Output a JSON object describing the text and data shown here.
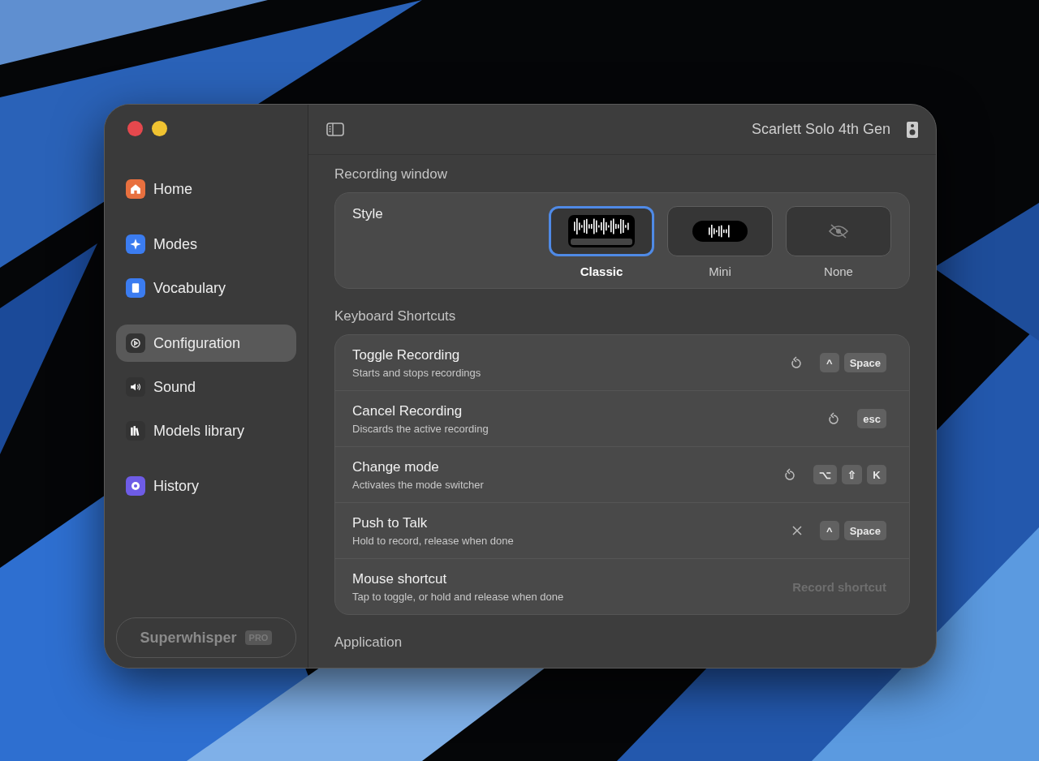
{
  "sidebar": {
    "traffic_lights": [
      {
        "color": "#e5484d"
      },
      {
        "color": "#f0c331"
      }
    ],
    "groups": [
      [
        {
          "label": "Home",
          "kind": "home",
          "color": "#e8703f",
          "selected": false
        }
      ],
      [
        {
          "label": "Modes",
          "kind": "sparkle",
          "color": "#3b7cf0",
          "selected": false
        },
        {
          "label": "Vocabulary",
          "kind": "book",
          "color": "#3b7cf0",
          "selected": false
        }
      ],
      [
        {
          "label": "Configuration",
          "kind": "gear",
          "color": "#333333",
          "selected": true
        },
        {
          "label": "Sound",
          "kind": "speaker",
          "color": "#333333",
          "selected": false
        },
        {
          "label": "Models library",
          "kind": "library",
          "color": "#333333",
          "selected": false
        }
      ],
      [
        {
          "label": "History",
          "kind": "shell",
          "color": "#6e5ce6",
          "selected": false
        }
      ]
    ],
    "footer": {
      "label": "Superwhisper",
      "badge": "PRO"
    }
  },
  "toolbar": {
    "device": "Scarlett Solo 4th Gen"
  },
  "recording_window": {
    "heading": "Recording window",
    "label": "Style",
    "options": [
      {
        "label": "Classic",
        "kind": "classic",
        "selected": true
      },
      {
        "label": "Mini",
        "kind": "mini",
        "selected": false
      },
      {
        "label": "None",
        "kind": "none",
        "selected": false
      }
    ]
  },
  "shortcuts": {
    "heading": "Keyboard Shortcuts",
    "rows": [
      {
        "title": "Toggle Recording",
        "subtitle": "Starts and stops recordings",
        "kind": "keys",
        "button": {
          "kind": "reset"
        },
        "keys": [
          "^",
          "Space"
        ]
      },
      {
        "title": "Cancel Recording",
        "subtitle": "Discards the active recording",
        "kind": "keys",
        "button": {
          "kind": "reset"
        },
        "keys": [
          "esc"
        ]
      },
      {
        "title": "Change mode",
        "subtitle": "Activates the mode switcher",
        "kind": "keys",
        "button": {
          "kind": "reset"
        },
        "keys": [
          "⌥",
          "⇧",
          "K"
        ]
      },
      {
        "title": "Push to Talk",
        "subtitle": "Hold to record, release when done",
        "kind": "keys",
        "button": {
          "kind": "clear"
        },
        "keys": [
          "^",
          "Space"
        ]
      },
      {
        "title": "Mouse shortcut",
        "subtitle": "Tap to toggle, or hold and release when done",
        "kind": "record",
        "placeholder": "Record shortcut"
      }
    ]
  },
  "next_heading": "Application"
}
